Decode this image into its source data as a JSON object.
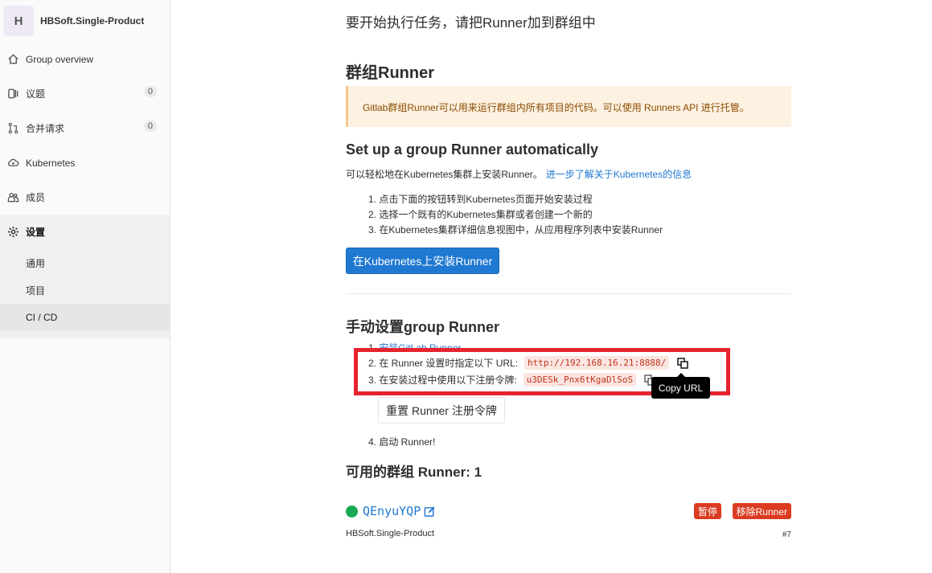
{
  "sidebar": {
    "group_initial": "H",
    "group_name": "HBSoft.Single-Product",
    "items": [
      {
        "label": "Group overview",
        "icon": "home-icon"
      },
      {
        "label": "议题",
        "icon": "issues-icon",
        "badge": "0"
      },
      {
        "label": "合并请求",
        "icon": "merge-request-icon",
        "badge": "0"
      },
      {
        "label": "Kubernetes",
        "icon": "cloud-gear-icon"
      },
      {
        "label": "成员",
        "icon": "users-icon"
      },
      {
        "label": "设置",
        "icon": "gear-icon"
      }
    ],
    "sub_items": [
      {
        "label": "通用"
      },
      {
        "label": "项目"
      },
      {
        "label": "CI / CD"
      }
    ]
  },
  "main": {
    "intro": "要开始执行任务，请把Runner加到群组中",
    "group_runner_title": "群组Runner",
    "notice": "Gitlab群组Runner可以用来运行群组内所有项目的代码。可以使用 Runners API 进行托管。",
    "auto_title": "Set up a group Runner automatically",
    "auto_desc": "可以轻松地在Kubernetes集群上安装Runner。",
    "auto_link": "进一步了解关于Kubernetes的信息",
    "auto_steps": [
      "1. 点击下面的按钮转到Kubernetes页面开始安装过程",
      "2. 选择一个既有的Kubernetes集群或者创建一个新的",
      "3. 在Kubernetes集群详细信息视图中，从应用程序列表中安装Runner"
    ],
    "k8s_button": "在Kubernetes上安装Runner",
    "manual_title": "手动设置group Runner",
    "manual_step1_prefix": "1. ",
    "manual_step1_link": "安装GitLab Runner",
    "manual_step2": "2. 在 Runner 设置时指定以下 URL:",
    "runner_url": "http://192.168.16.21:8888/",
    "manual_step3": "3. 在安装过程中使用以下注册令牌:",
    "token": "u3DESk_Pnx6tKgaDlSoS",
    "tooltip": "Copy URL",
    "reset_button": "重置 Runner 注册令牌",
    "manual_step4": "4. 启动 Runner!",
    "available_title": "可用的群组 Runner: 1",
    "runner": {
      "id": "QEnyuYQP",
      "pause_label": "暂停",
      "remove_label": "移除Runner",
      "group": "HBSoft.Single-Product",
      "number": "#7"
    }
  },
  "colors": {
    "primary": "#1f78d1",
    "danger": "#db3b21",
    "success": "#1aaa55",
    "highlight": "#e5242f"
  }
}
